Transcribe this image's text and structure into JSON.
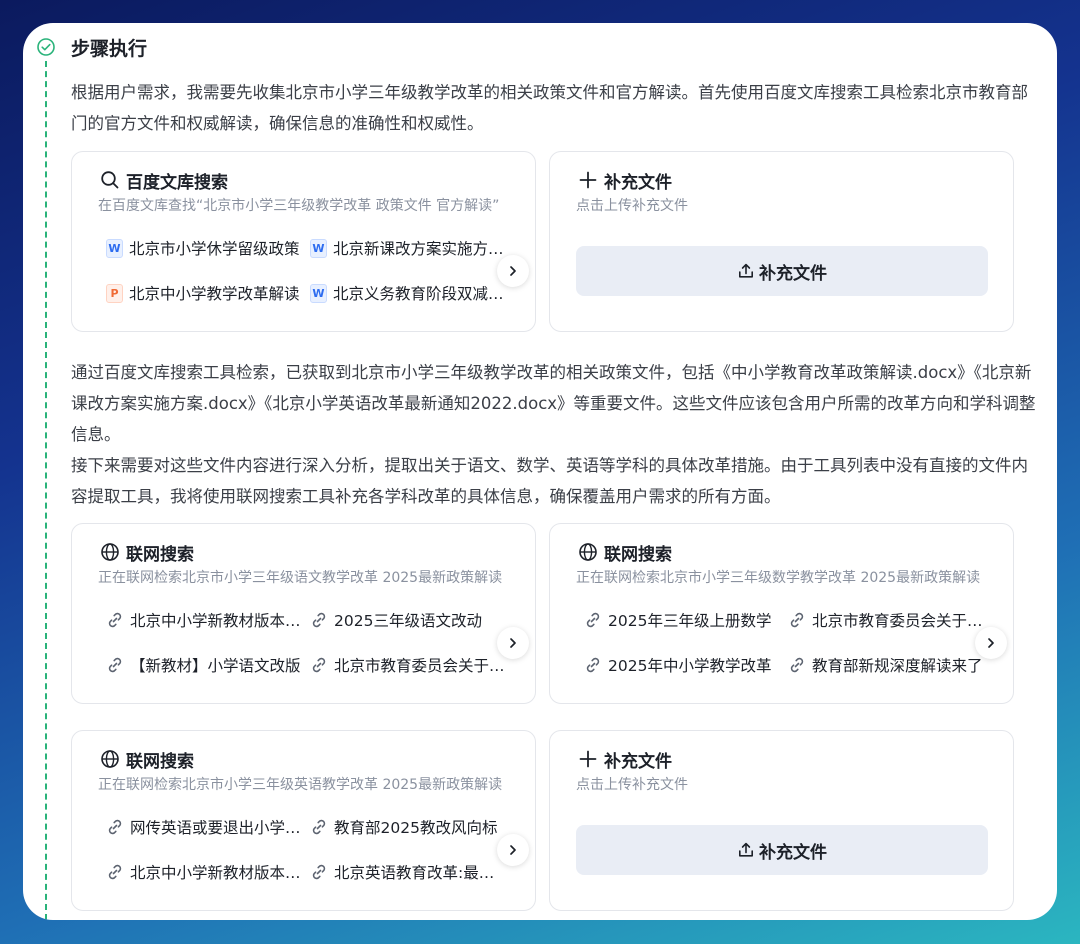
{
  "step": {
    "title": "步骤执行"
  },
  "paragraphs": {
    "p1": "根据用户需求，我需要先收集北京市小学三年级教学改革的相关政策文件和官方解读。首先使用百度文库搜索工具检索北京市教育部门的官方文件和权威解读，确保信息的准确性和权威性。",
    "p2": "通过百度文库搜索工具检索，已获取到北京市小学三年级教学改革的相关政策文件，包括《中小学教育改革政策解读.docx》《北京新课改方案实施方案.docx》《北京小学英语改革最新通知2022.docx》等重要文件。这些文件应该包含用户所需的改革方向和学科调整信息。",
    "p3": "接下来需要对这些文件内容进行深入分析，提取出关于语文、数学、英语等学科的具体改革措施。由于工具列表中没有直接的文件内容提取工具，我将使用联网搜索工具补充各学科改革的具体信息，确保覆盖用户需求的所有方面。"
  },
  "baidu_card": {
    "title": "百度文库搜索",
    "subtitle": "在百度文库查找“北京市小学三年级教学改革 政策文件 官方解读”",
    "items": [
      {
        "icon": "word-doc-icon",
        "type": "W",
        "label": "北京市小学休学留级政策"
      },
      {
        "icon": "word-doc-icon",
        "type": "W",
        "label": "北京新课改方案实施方案.docx"
      },
      {
        "icon": "ppt-doc-icon",
        "type": "P",
        "label": "北京中小学教学改革解读"
      },
      {
        "icon": "word-doc-icon",
        "type": "W",
        "label": "北京义务教育阶段双减政策"
      }
    ]
  },
  "upload_card_1": {
    "title": "补充文件",
    "subtitle": "点击上传补充文件",
    "button": "补充文件"
  },
  "web_card_1": {
    "title": "联网搜索",
    "subtitle": "正在联网检索北京市小学三年级语文教学改革 2025最新政策解读",
    "items": [
      {
        "label": "北京中小学新教材版本变化"
      },
      {
        "label": "2025三年级语文改动"
      },
      {
        "label": "【新教材】小学语文改版"
      },
      {
        "label": "北京市教育委员会关于印发"
      }
    ]
  },
  "web_card_2": {
    "title": "联网搜索",
    "subtitle": "正在联网检索北京市小学三年级数学教学改革 2025最新政策解读",
    "items": [
      {
        "label": "2025年三年级上册数学"
      },
      {
        "label": "北京市教育委员会关于印发"
      },
      {
        "label": "2025年中小学教学改革"
      },
      {
        "label": "教育部新规深度解读来了"
      }
    ]
  },
  "web_card_3": {
    "title": "联网搜索",
    "subtitle": "正在联网检索北京市小学三年级英语教学改革 2025最新政策解读",
    "items": [
      {
        "label": "网传英语或要退出小学课堂"
      },
      {
        "label": "教育部2025教改风向标"
      },
      {
        "label": "北京中小学新教材版本变化"
      },
      {
        "label": "北京英语教育改革:最新动态"
      }
    ]
  },
  "upload_card_2": {
    "title": "补充文件",
    "subtitle": "点击上传补充文件",
    "button": "补充文件"
  },
  "colors": {
    "timeline": "#2ab37a",
    "word": "#2d6cf0",
    "ppt": "#f06a35",
    "button_bg": "#e9edf5"
  }
}
